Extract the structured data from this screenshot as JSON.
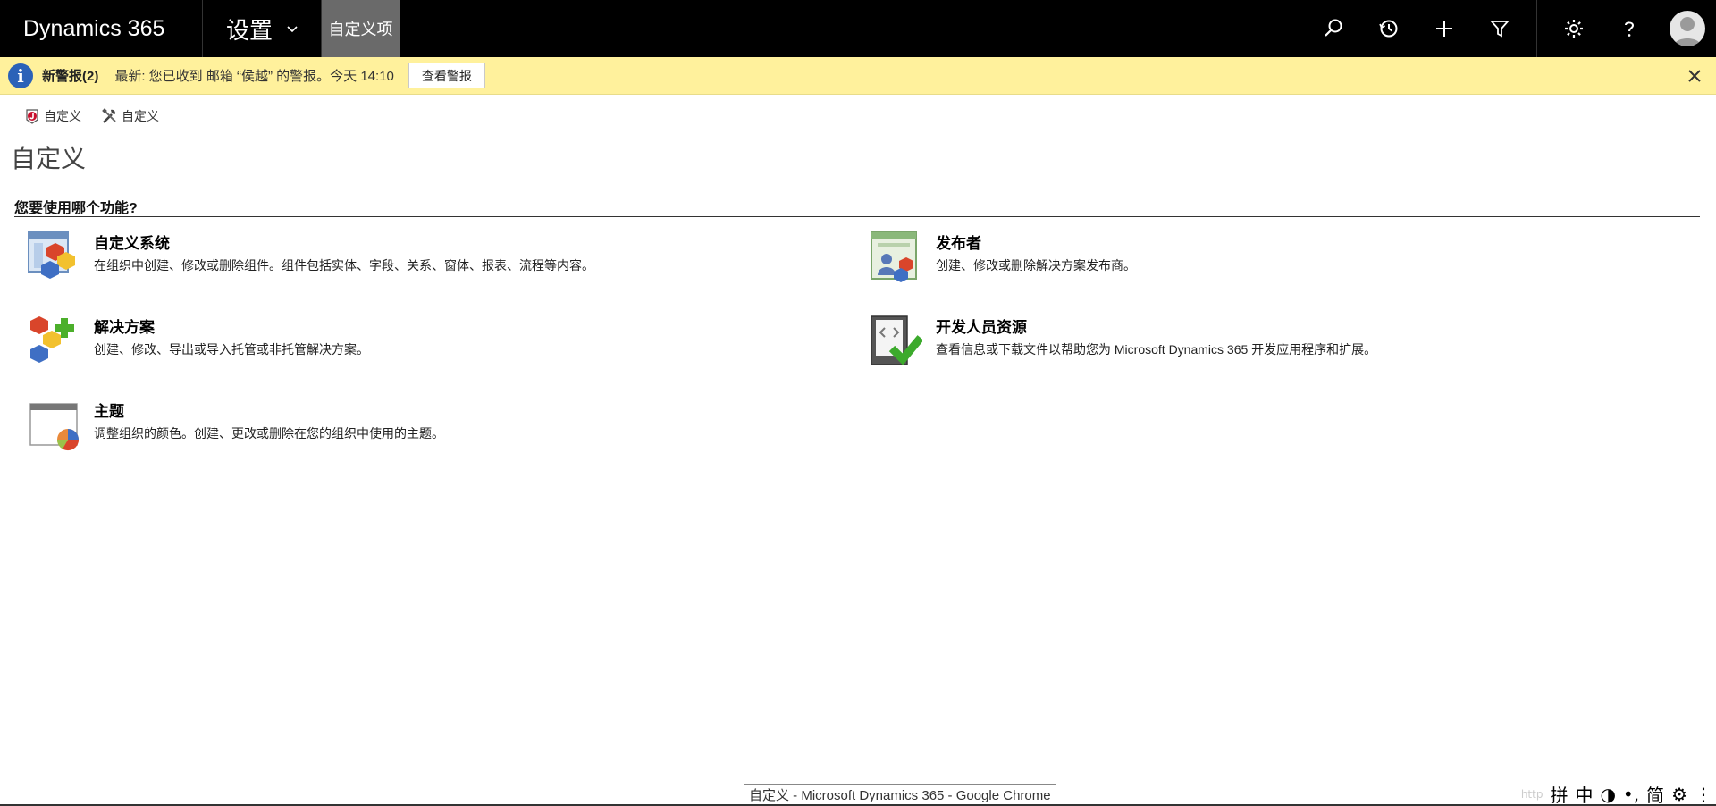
{
  "topbar": {
    "brand": "Dynamics 365",
    "area": "设置",
    "breadcrumb_tab": "自定义项",
    "icons": [
      "search-icon",
      "history-icon",
      "plus-icon",
      "filter-icon",
      "gear-icon",
      "help-icon",
      "avatar-icon"
    ]
  },
  "alert": {
    "title": "新警报(2)",
    "message": "最新: 您已收到 邮箱 “侯越” 的警报。今天 14:10",
    "button": "查看警报",
    "bg_color": "#fff19c"
  },
  "commands": [
    {
      "label": "自定义",
      "icon": "solution-icon"
    },
    {
      "label": "自定义",
      "icon": "tools-icon"
    }
  ],
  "page": {
    "title": "自定义",
    "section_heading": "您要使用哪个功能?"
  },
  "features": {
    "customize": {
      "title": "自定义系统",
      "desc": "在组织中创建、修改或删除组件。组件包括实体、字段、关系、窗体、报表、流程等内容。"
    },
    "solutions": {
      "title": "解决方案",
      "desc": "创建、修改、导出或导入托管或非托管解决方案。"
    },
    "themes": {
      "title": "主题",
      "desc": "调整组织的颜色。创建、更改或删除在您的组织中使用的主题。"
    },
    "publishers": {
      "title": "发布者",
      "desc": "创建、修改或删除解决方案发布商。"
    },
    "dev_resources": {
      "title": "开发人员资源",
      "desc": "查看信息或下载文件以帮助您为 Microsoft Dynamics 365 开发应用程序和扩展。"
    }
  },
  "window_tooltip": "自定义 - Microsoft Dynamics 365 - Google Chrome",
  "ime": {
    "items": [
      "拼",
      "中",
      "◑",
      "•,",
      "简",
      "⚙",
      "⋮"
    ]
  }
}
